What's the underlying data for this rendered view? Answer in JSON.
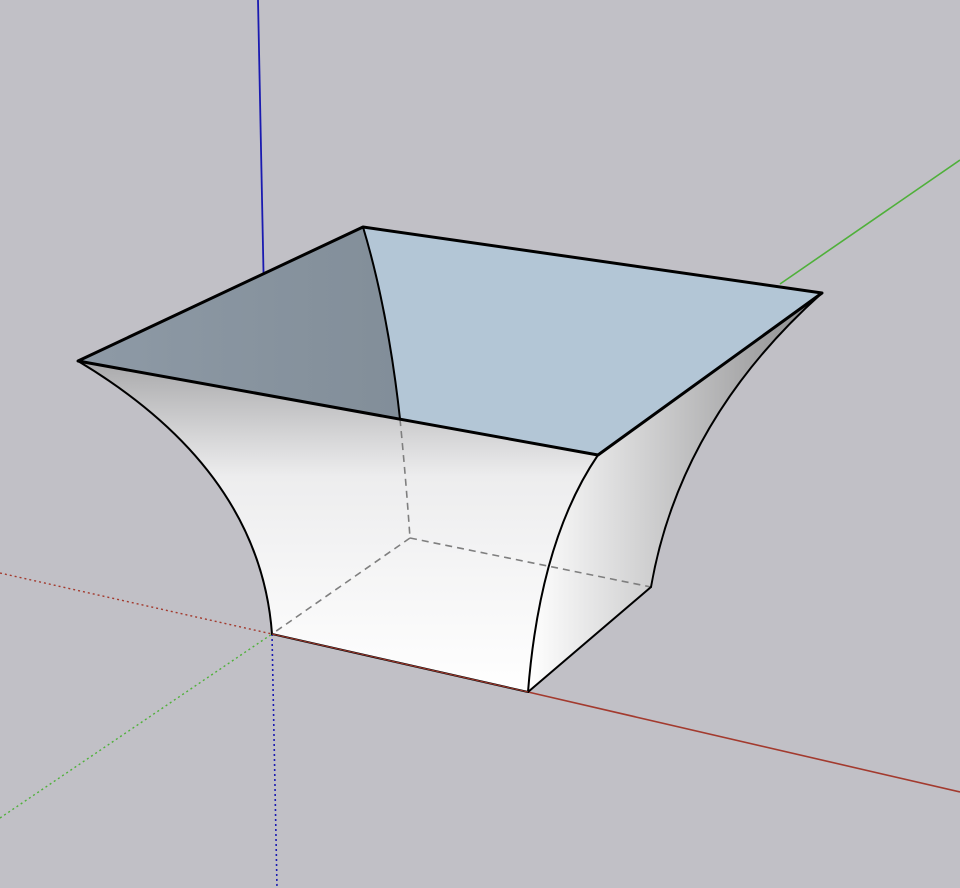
{
  "viewport": {
    "background": "#c1c0c6"
  },
  "axes": {
    "red_color": "#a33a2e",
    "green_color": "#4fb03a",
    "blue_color": "#1a1ab0"
  },
  "model": {
    "name": "flared-square-vase",
    "edge_color": "#000000",
    "hidden_edge_color": "#7f7f7f",
    "interior_face_color": "#b3c6d6",
    "exterior_face_color": "#ffffff"
  }
}
